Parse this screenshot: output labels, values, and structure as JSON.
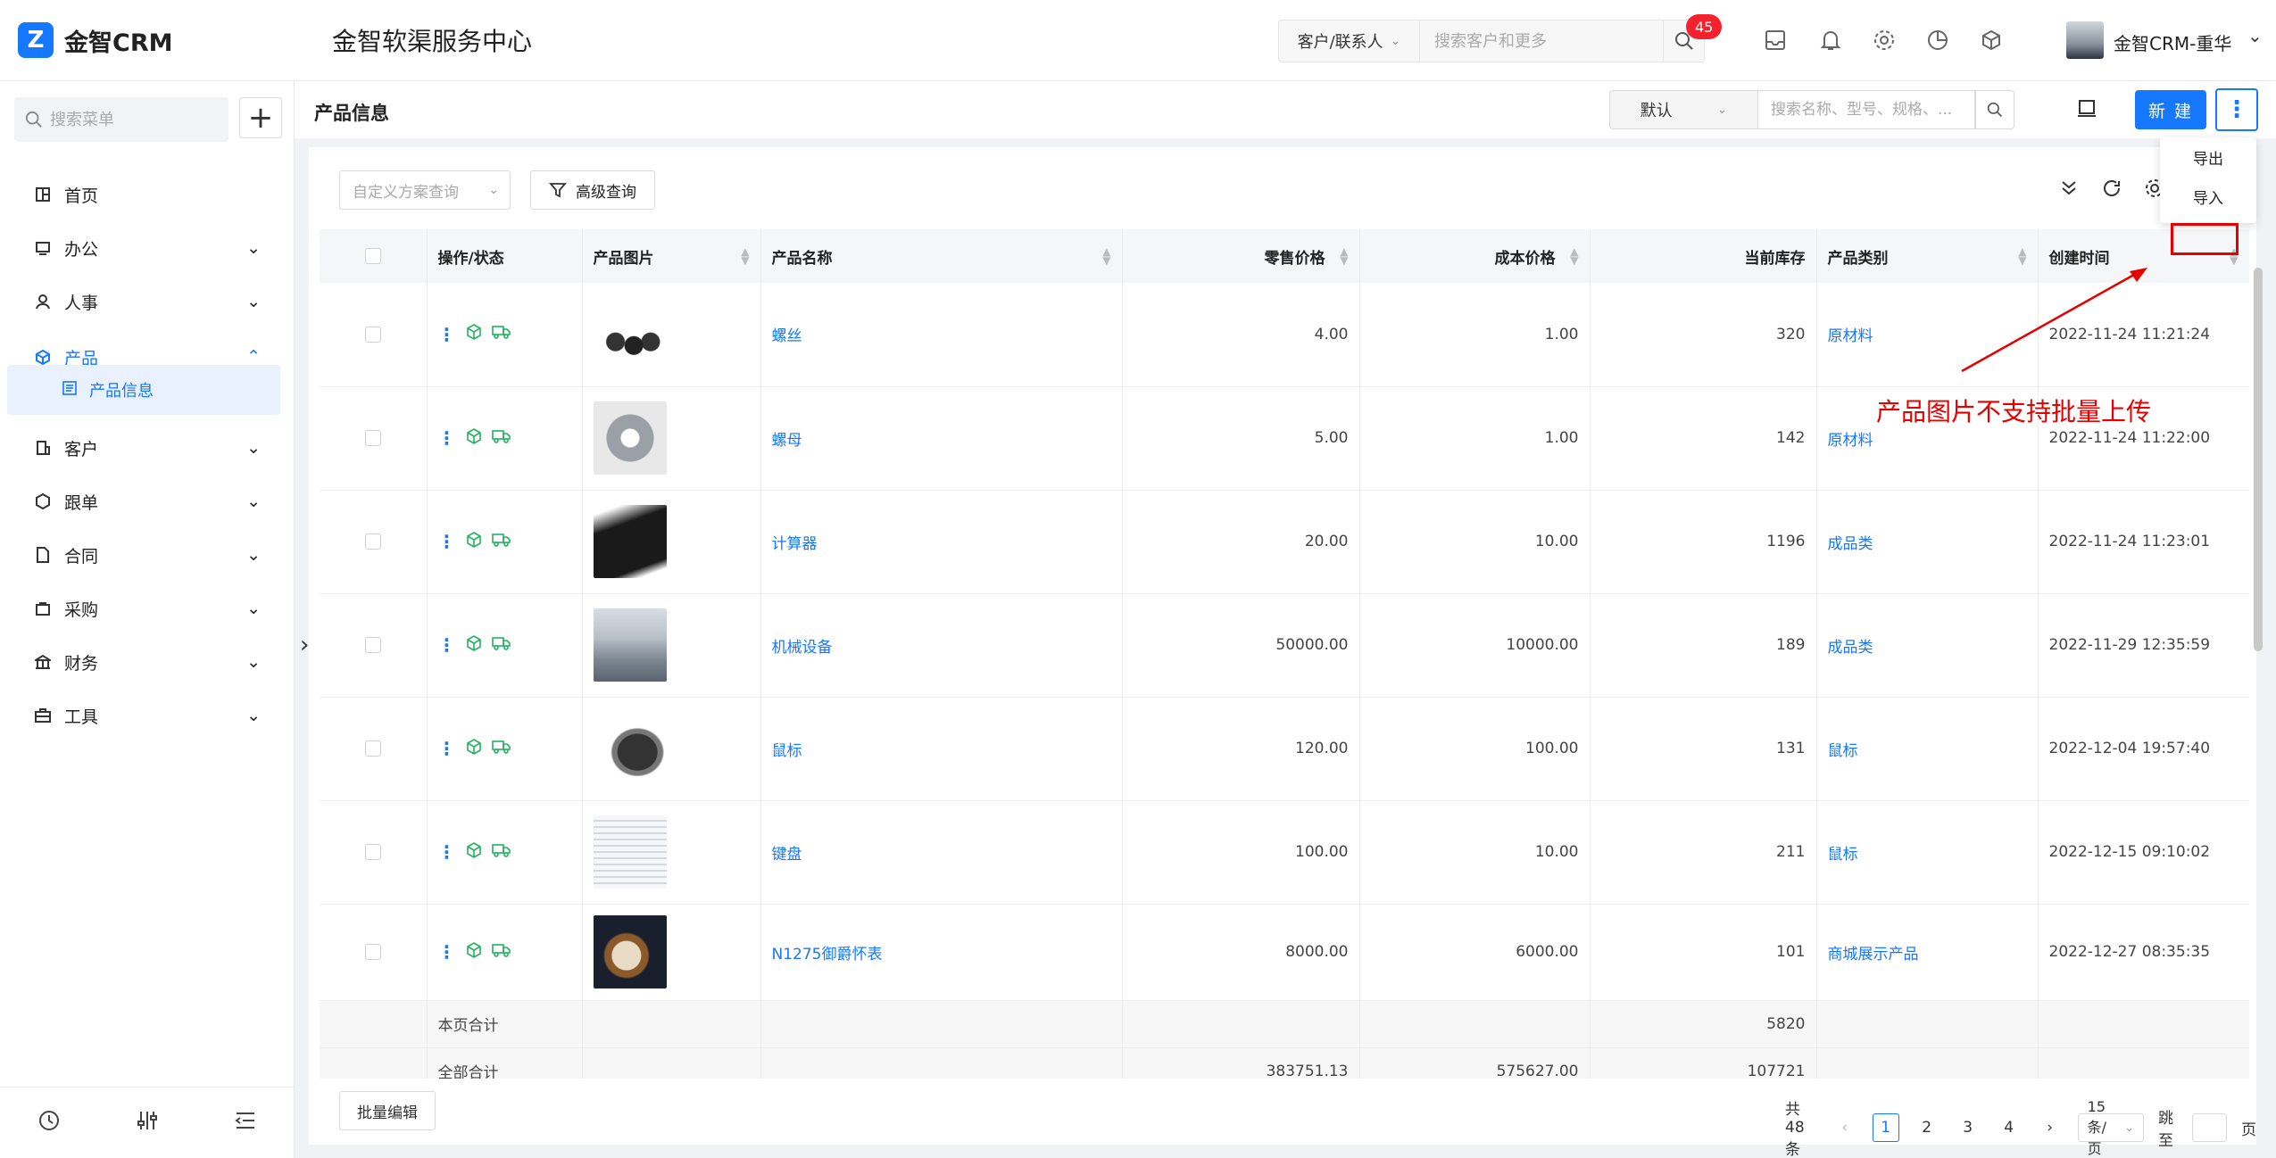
{
  "top": {
    "logo_mark": "Z",
    "logo_text": "金智CRM",
    "app_title": "金智软渠服务中心",
    "search_scope": "客户/联系人",
    "search_placeholder": "搜索客户和更多",
    "notification_count": "45",
    "user_name": "金智CRM-重华"
  },
  "sidebar": {
    "search_placeholder": "搜索菜单",
    "items": [
      {
        "label": "首页"
      },
      {
        "label": "办公"
      },
      {
        "label": "人事"
      },
      {
        "label": "产品"
      },
      {
        "label": "客户"
      },
      {
        "label": "跟单"
      },
      {
        "label": "合同"
      },
      {
        "label": "采购"
      },
      {
        "label": "财务"
      },
      {
        "label": "工具"
      }
    ],
    "sub_item": "产品信息"
  },
  "header": {
    "page_title": "产品信息",
    "view_value": "默认",
    "search_placeholder": "搜索名称、型号、规格、...",
    "new_label": "新 建"
  },
  "toolbar": {
    "scheme_placeholder": "自定义方案查询",
    "advanced_label": "高级查询"
  },
  "dropdown": {
    "export_label": "导出",
    "import_label": "导入"
  },
  "table": {
    "columns": [
      "操作/状态",
      "产品图片",
      "产品名称",
      "零售价格",
      "成本价格",
      "当前库存",
      "产品类别",
      "创建时间"
    ],
    "rows": [
      {
        "name": "螺丝",
        "retail": "4.00",
        "cost": "1.00",
        "stock": "320",
        "category": "原材料",
        "created": "2022-11-24 11:21:24"
      },
      {
        "name": "螺母",
        "retail": "5.00",
        "cost": "1.00",
        "stock": "142",
        "category": "原材料",
        "created": "2022-11-24 11:22:00"
      },
      {
        "name": "计算器",
        "retail": "20.00",
        "cost": "10.00",
        "stock": "1196",
        "category": "成品类",
        "created": "2022-11-24 11:23:01"
      },
      {
        "name": "机械设备",
        "retail": "50000.00",
        "cost": "10000.00",
        "stock": "189",
        "category": "成品类",
        "created": "2022-11-29 12:35:59"
      },
      {
        "name": "鼠标",
        "retail": "120.00",
        "cost": "100.00",
        "stock": "131",
        "category": "鼠标",
        "created": "2022-12-04 19:57:40"
      },
      {
        "name": "键盘",
        "retail": "100.00",
        "cost": "10.00",
        "stock": "211",
        "category": "鼠标",
        "created": "2022-12-15 09:10:02"
      },
      {
        "name": "N1275御爵怀表",
        "retail": "8000.00",
        "cost": "6000.00",
        "stock": "101",
        "category": "商城展示产品",
        "created": "2022-12-27 08:35:35"
      }
    ],
    "page_total": {
      "label": "本页合计",
      "stock": "5820"
    },
    "all_total": {
      "label": "全部合计",
      "retail": "383751.13",
      "cost": "575627.00",
      "stock": "107721"
    }
  },
  "pager": {
    "batch_label": "批量编辑",
    "total": "共48条",
    "pages": [
      "1",
      "2",
      "3",
      "4"
    ],
    "page_size": "15 条/页",
    "jump_label": "跳至",
    "page_suffix": "页"
  },
  "annotation": "产品图片不支持批量上传",
  "colors": {
    "accent": "#1677ff",
    "annotation": "#e60000",
    "badge": "#f5222d"
  }
}
